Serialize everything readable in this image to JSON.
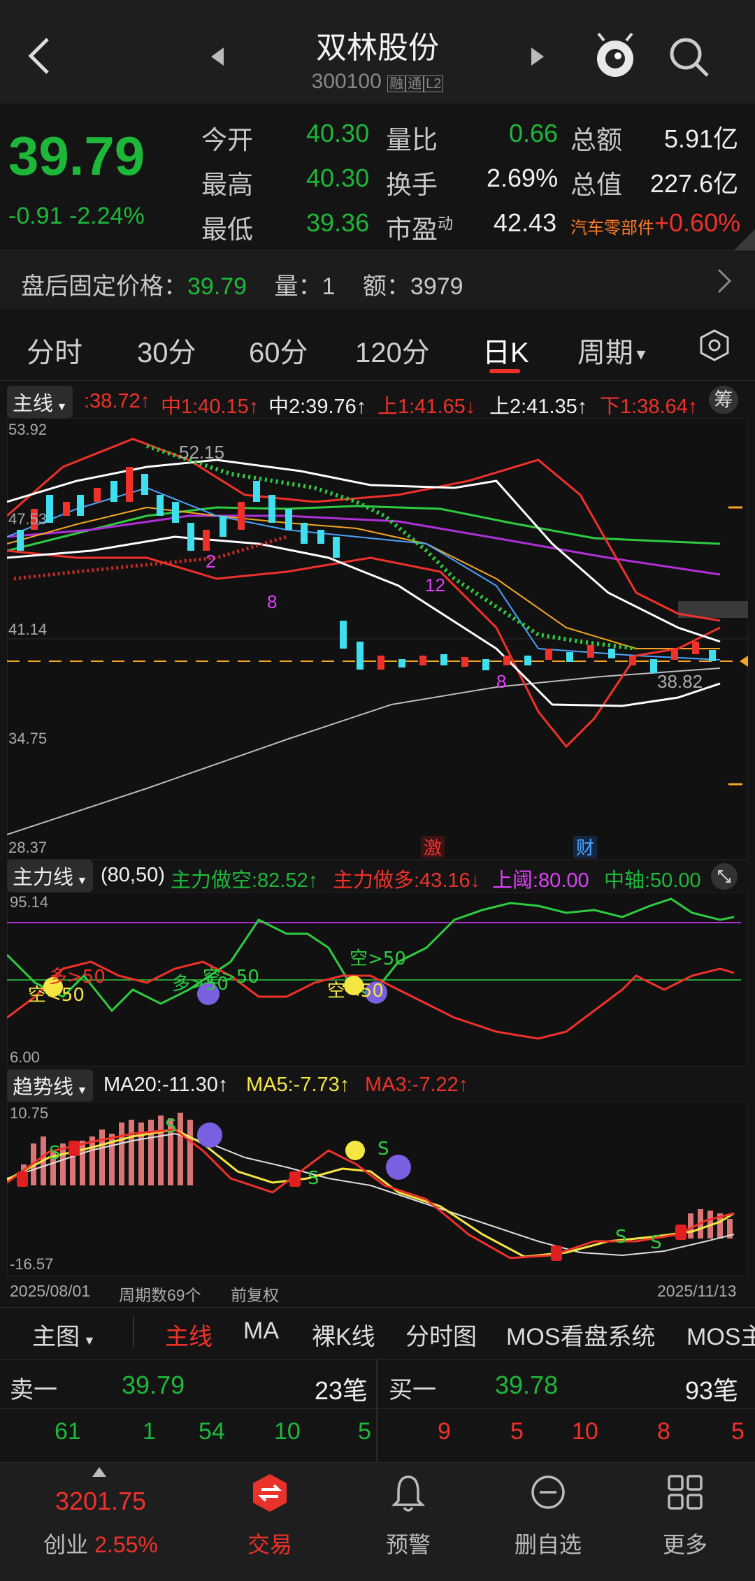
{
  "header": {
    "stock_name": "双林股份",
    "stock_code": "300100",
    "badges": [
      "融",
      "通",
      "L2"
    ]
  },
  "quote": {
    "price": "39.79",
    "change": "-0.91",
    "change_pct": "-2.24%",
    "open_label": "今开",
    "open": "40.30",
    "high_label": "最高",
    "high": "40.30",
    "low_label": "最低",
    "low": "39.36",
    "vol_ratio_label": "量比",
    "vol_ratio": "0.66",
    "turnover_label": "换手",
    "turnover": "2.69%",
    "pe_label": "市盈",
    "pe_sup": "动",
    "pe": "42.43",
    "amount_label": "总额",
    "amount": "5.91亿",
    "mktcap_label": "总值",
    "mktcap": "227.6亿",
    "sector": "汽车零部件",
    "sector_change": "+0.60%"
  },
  "after_hours": {
    "label": "盘后固定价格：",
    "price": "39.79",
    "vol_label": "量：",
    "vol": "1",
    "amt_label": "额：",
    "amt": "3979"
  },
  "period_tabs": [
    "分时",
    "30分",
    "60分",
    "120分",
    "日K",
    "周期"
  ],
  "active_tab": "日K",
  "main_chart": {
    "selector": "主线",
    "indicators": {
      "a": ":38.72↑",
      "mid1": "中1:40.15↑",
      "mid2": "中2:39.76↑",
      "up1": "上1:41.65↓",
      "up2": "上2:41.35↑",
      "down1": "下1:38.64↑"
    },
    "chip_icon": "筹",
    "y_labels": [
      "53.92",
      "47.53",
      "41.14",
      "34.75",
      "28.37"
    ],
    "annotations": [
      "52.15",
      "38.82",
      "2",
      "8",
      "12",
      "8"
    ],
    "event_tags": [
      "激",
      "财"
    ]
  },
  "main_force": {
    "selector": "主力线",
    "params": "(80,50)",
    "short": "主力做空:82.52↑",
    "long": "主力做多:43.16↓",
    "upper": "上阈:80.00",
    "middle": "中轴:50.00",
    "y_top": "95.14",
    "y_bottom": "6.00",
    "labels": [
      "多>50",
      "空<50",
      "多>50",
      "空>50",
      "空>50",
      "空<50"
    ]
  },
  "trend": {
    "selector": "趋势线",
    "ma20": "MA20:-11.30↑",
    "ma5": "MA5:-7.73↑",
    "ma3": "MA3:-7.22↑",
    "y_top": "10.75",
    "y_bottom": "-16.57",
    "date_start": "2025/08/01",
    "period_count": "周期数69个",
    "adjust": "前复权",
    "date_end": "2025/11/13"
  },
  "bottom_tabs": {
    "main_graph": "主图",
    "items": [
      "主线",
      "MA",
      "裸K线",
      "分时图",
      "MOS看盘系统",
      "MOS主"
    ]
  },
  "order_book": {
    "sell1_label": "卖一",
    "sell1_price": "39.79",
    "sell1_count": "23笔",
    "buy1_label": "买一",
    "buy1_price": "39.78",
    "buy1_count": "93笔",
    "sell_queue": [
      "61",
      "1",
      "54",
      "10",
      "5"
    ],
    "buy_queue": [
      "9",
      "5",
      "10",
      "8",
      "5"
    ]
  },
  "nav": {
    "index_value": "3201.75",
    "index_name": "创业",
    "index_change": "2.55%",
    "trade": "交易",
    "alert": "预警",
    "remove": "删自选",
    "more": "更多"
  },
  "colors": {
    "up": "#f0312a",
    "down": "#1db83a",
    "candle_down": "#3ee0f0",
    "accent": "#f0312a"
  }
}
